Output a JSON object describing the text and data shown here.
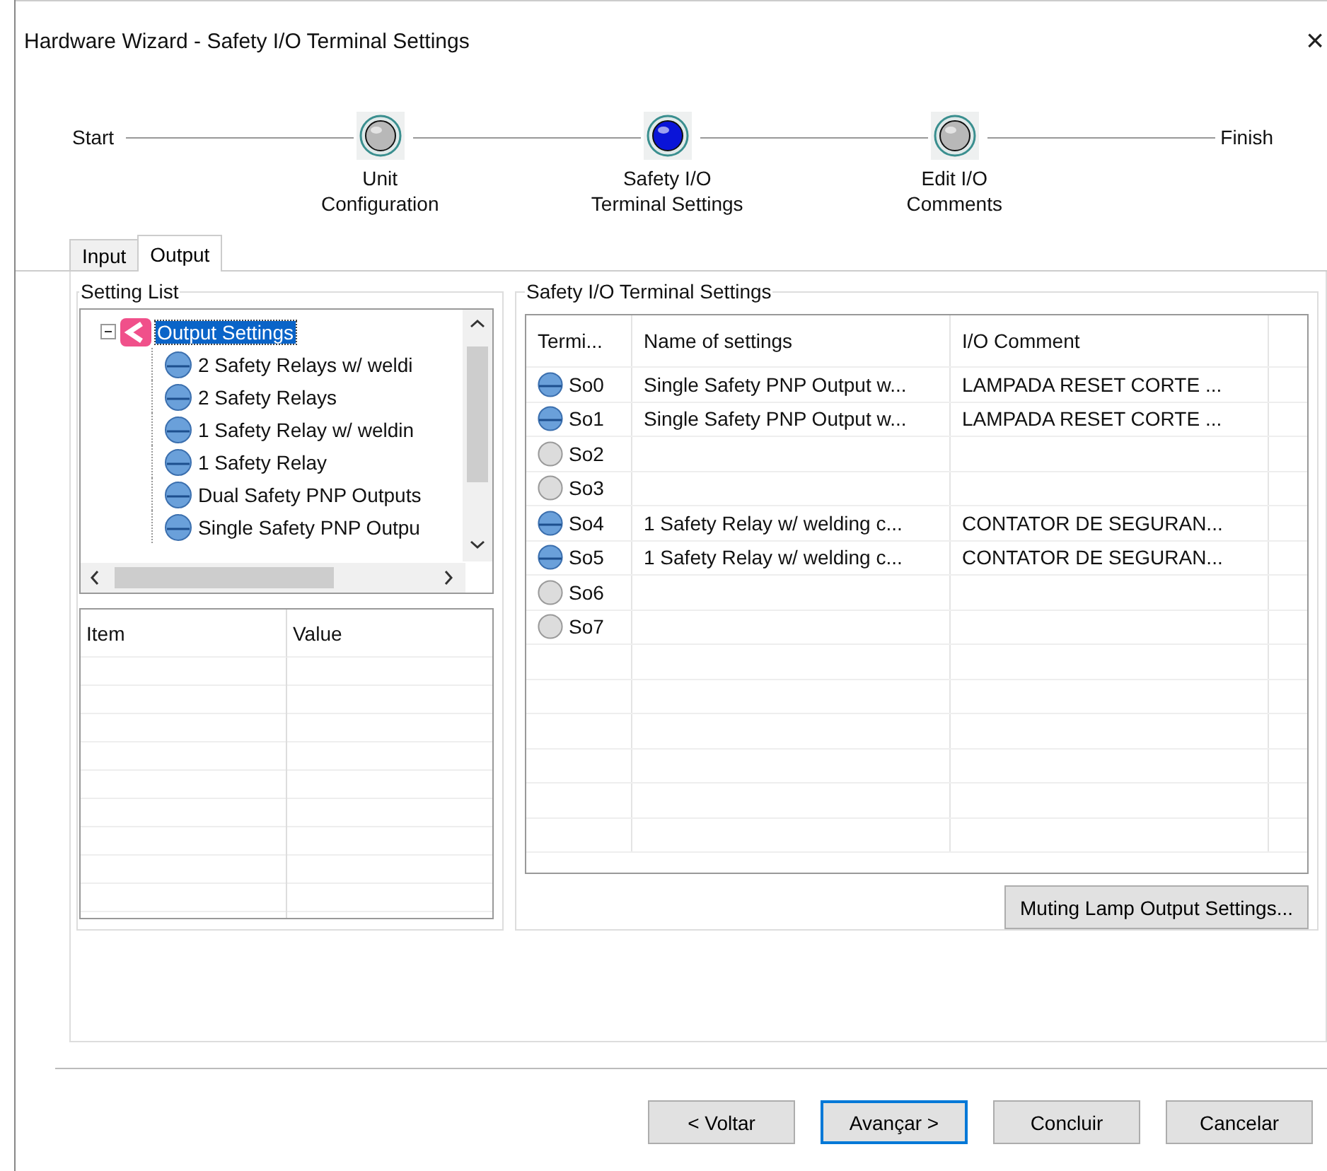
{
  "window": {
    "title": "Hardware Wizard - Safety I/O Terminal Settings",
    "close": "×"
  },
  "steps": {
    "start": "Start",
    "finish": "Finish",
    "items": [
      {
        "label": [
          "Unit",
          "Configuration"
        ],
        "selected": false
      },
      {
        "label": [
          "Safety I/O",
          "Terminal Settings"
        ],
        "selected": true
      },
      {
        "label": [
          "Edit I/O",
          "Comments"
        ],
        "selected": false
      }
    ]
  },
  "tabs": [
    {
      "label": "Input",
      "selected": false
    },
    {
      "label": "Output",
      "selected": true
    }
  ],
  "setting_list": {
    "title": "Setting List",
    "root": {
      "label": "Output Settings",
      "selected": true,
      "expanded": true,
      "children": [
        {
          "label": "2 Safety Relays w/ weldi"
        },
        {
          "label": "2 Safety Relays"
        },
        {
          "label": "1 Safety Relay w/ weldin"
        },
        {
          "label": "1 Safety Relay"
        },
        {
          "label": "Dual Safety PNP Outputs"
        },
        {
          "label": "Single Safety PNP Outpu"
        }
      ]
    },
    "property_columns": [
      "Item",
      "Value"
    ]
  },
  "terminal_settings": {
    "title": "Safety I/O Terminal Settings",
    "columns": [
      "Termi...",
      "Name of settings",
      "I/O Comment"
    ],
    "rows": [
      {
        "terminal": "So0",
        "assigned": true,
        "name": "Single Safety PNP Output w...",
        "comment": "LAMPADA RESET CORTE ..."
      },
      {
        "terminal": "So1",
        "assigned": true,
        "name": "Single Safety PNP Output w...",
        "comment": "LAMPADA RESET CORTE ..."
      },
      {
        "terminal": "So2",
        "assigned": false
      },
      {
        "terminal": "So3",
        "assigned": false
      },
      {
        "terminal": "So4",
        "assigned": true,
        "name": "1 Safety Relay w/ welding c...",
        "comment": "CONTATOR DE SEGURAN..."
      },
      {
        "terminal": "So5",
        "assigned": true,
        "name": "1 Safety Relay w/ welding c...",
        "comment": "CONTATOR DE SEGURAN..."
      },
      {
        "terminal": "So6",
        "assigned": false
      },
      {
        "terminal": "So7",
        "assigned": false
      }
    ],
    "button": "Muting Lamp Output Settings..."
  },
  "buttons": [
    {
      "label": "< Voltar",
      "default": false
    },
    {
      "label": "Avançar >",
      "default": true
    },
    {
      "label": "Concluir",
      "default": false
    },
    {
      "label": "Cancelar",
      "default": false
    }
  ]
}
